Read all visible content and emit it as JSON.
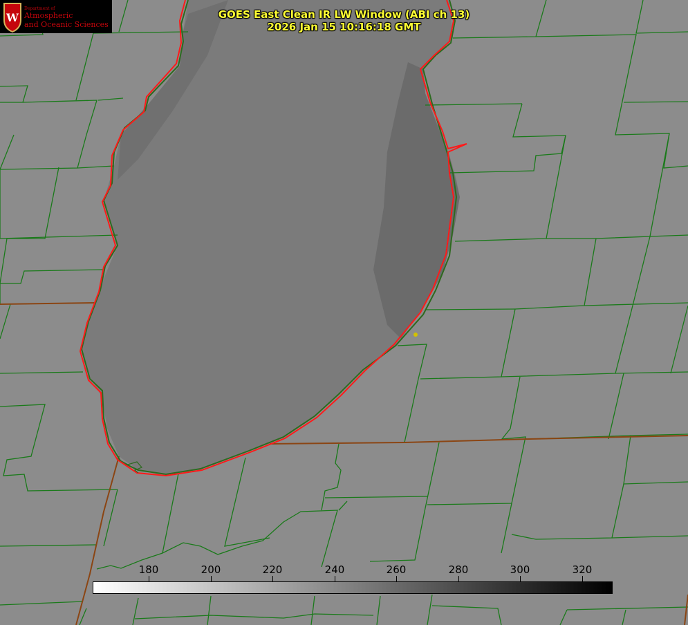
{
  "logo": {
    "emblem": "uw-crest-icon",
    "department": "Department of",
    "line1": "Atmospheric",
    "line2": "and Oceanic Sciences",
    "color": "#c5050c"
  },
  "header": {
    "title": "GOES East Clean IR LW Window (ABI ch 13)",
    "timestamp": "2026 Jan 15 10:16:18 GMT",
    "color": "#ffff33"
  },
  "colorbar": {
    "ticks": [
      "180",
      "200",
      "220",
      "240",
      "260",
      "280",
      "300",
      "320"
    ],
    "gradient": [
      "#ffffff",
      "#000000"
    ]
  },
  "map": {
    "county_line_color": "#1a7a1a",
    "coastline_color": "#ff1a1a",
    "state_line_color": "#8b4513",
    "marker_color": "#d4c200"
  }
}
